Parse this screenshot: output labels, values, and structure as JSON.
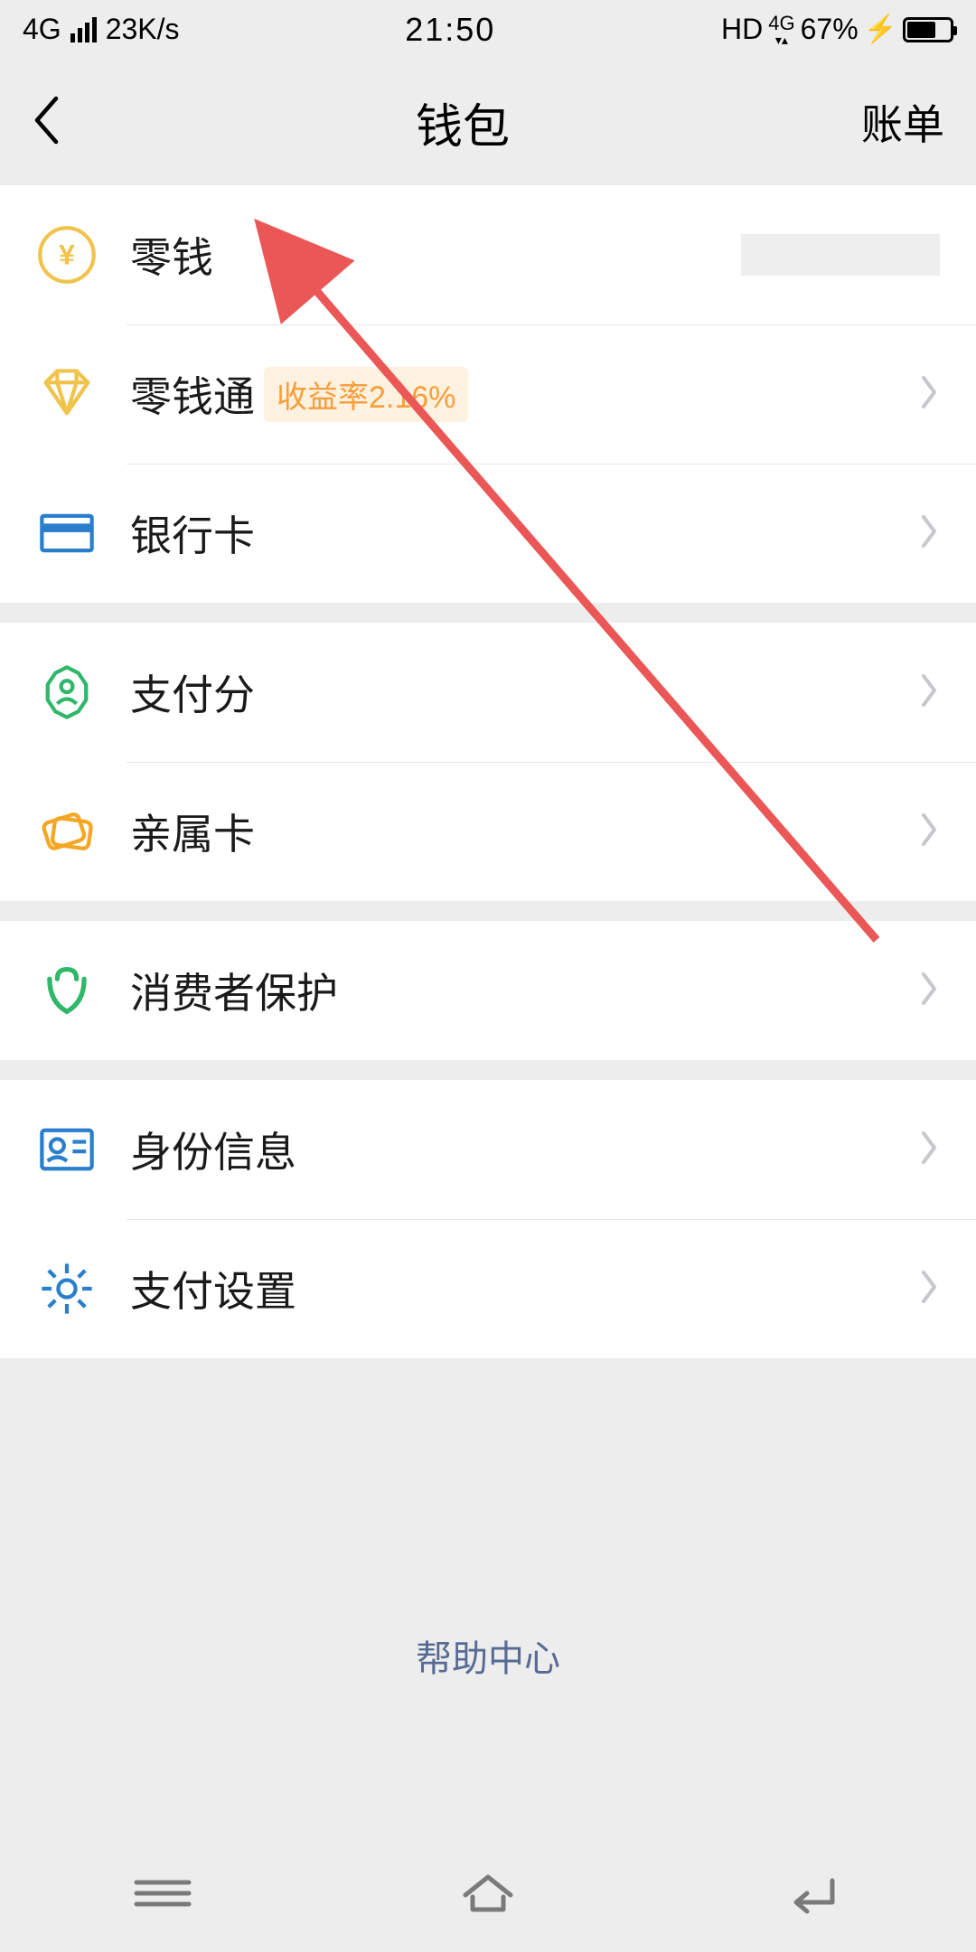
{
  "status": {
    "network": "4G",
    "speed": "23K/s",
    "time": "21:50",
    "hd": "HD",
    "signal2": "4G",
    "battery_pct": "67%"
  },
  "nav": {
    "title": "钱包",
    "right": "账单"
  },
  "rows": {
    "balance": {
      "label": "零钱"
    },
    "lqt": {
      "label": "零钱通",
      "badge": "收益率2.16%"
    },
    "bankcard": {
      "label": "银行卡"
    },
    "payscore": {
      "label": "支付分"
    },
    "familycard": {
      "label": "亲属卡"
    },
    "consumer": {
      "label": "消费者保护"
    },
    "identity": {
      "label": "身份信息"
    },
    "settings": {
      "label": "支付设置"
    }
  },
  "footer": {
    "help": "帮助中心"
  },
  "colors": {
    "yen": "#f0c34c",
    "diamond": "#f0c34c",
    "card": "#2a7fcc",
    "payscore": "#2fb76a",
    "family": "#f5a623",
    "consumer": "#2fb76a",
    "identity": "#2a7fcc",
    "gear": "#2a7fcc",
    "arrow": "#eb5757"
  }
}
